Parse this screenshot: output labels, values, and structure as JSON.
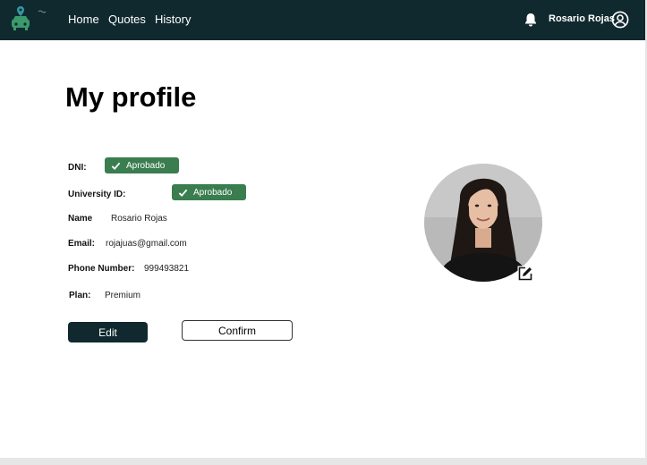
{
  "nav": {
    "links": [
      "Home",
      "Quotes",
      "History"
    ],
    "user_name": "Rosario Rojas"
  },
  "profile": {
    "title": "My profile",
    "dni": {
      "label": "DNI:",
      "status": "Aprobado"
    },
    "university_id": {
      "label": "University ID:",
      "status": "Aprobado"
    },
    "name": {
      "label": "Name",
      "value": "Rosario Rojas"
    },
    "email": {
      "label": "Email:",
      "value": "rojajuas@gmail.com"
    },
    "phone": {
      "label": "Phone Number:",
      "value": "999493821"
    },
    "plan": {
      "label": "Plan:",
      "value": "Premium"
    }
  },
  "actions": {
    "edit": "Edit",
    "confirm": "Confirm"
  },
  "colors": {
    "navbar": "#10292e",
    "badge": "#3a7d4f",
    "accent": "#2f9aa5"
  },
  "icons": [
    "car-logo-icon",
    "bell-icon",
    "user-circle-icon",
    "check-icon",
    "edit-pencil-icon"
  ]
}
